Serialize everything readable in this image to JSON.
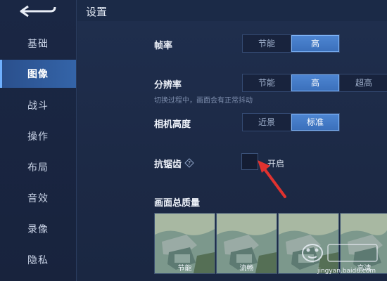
{
  "header": {
    "title": "设置"
  },
  "sidebar": {
    "items": [
      {
        "label": "基础",
        "active": false
      },
      {
        "label": "图像",
        "active": true
      },
      {
        "label": "战斗",
        "active": false
      },
      {
        "label": "操作",
        "active": false
      },
      {
        "label": "布局",
        "active": false
      },
      {
        "label": "音效",
        "active": false
      },
      {
        "label": "录像",
        "active": false
      },
      {
        "label": "隐私",
        "active": false
      }
    ]
  },
  "settings": {
    "frame_rate": {
      "label": "帧率",
      "options": [
        "节能",
        "高"
      ],
      "selected": "高"
    },
    "resolution": {
      "label": "分辨率",
      "options": [
        "节能",
        "高",
        "超高"
      ],
      "selected": "高",
      "hint": "切换过程中，画面会有正常抖动"
    },
    "camera_height": {
      "label": "相机高度",
      "options": [
        "近景",
        "标准"
      ],
      "selected": "标准"
    },
    "anti_aliasing": {
      "label": "抗锯齿",
      "toggle_label": "开启",
      "checked": false
    },
    "quality": {
      "label": "画面总质量",
      "thumbnails": [
        {
          "label": "节能"
        },
        {
          "label": "流畅"
        },
        {
          "label": ""
        },
        {
          "label": "高清"
        }
      ]
    }
  },
  "watermark": {
    "url": "jingyan.baidu.com"
  },
  "colors": {
    "accent": "#3a6fba",
    "arrow": "#e0322f",
    "background": "#1b2a47"
  }
}
